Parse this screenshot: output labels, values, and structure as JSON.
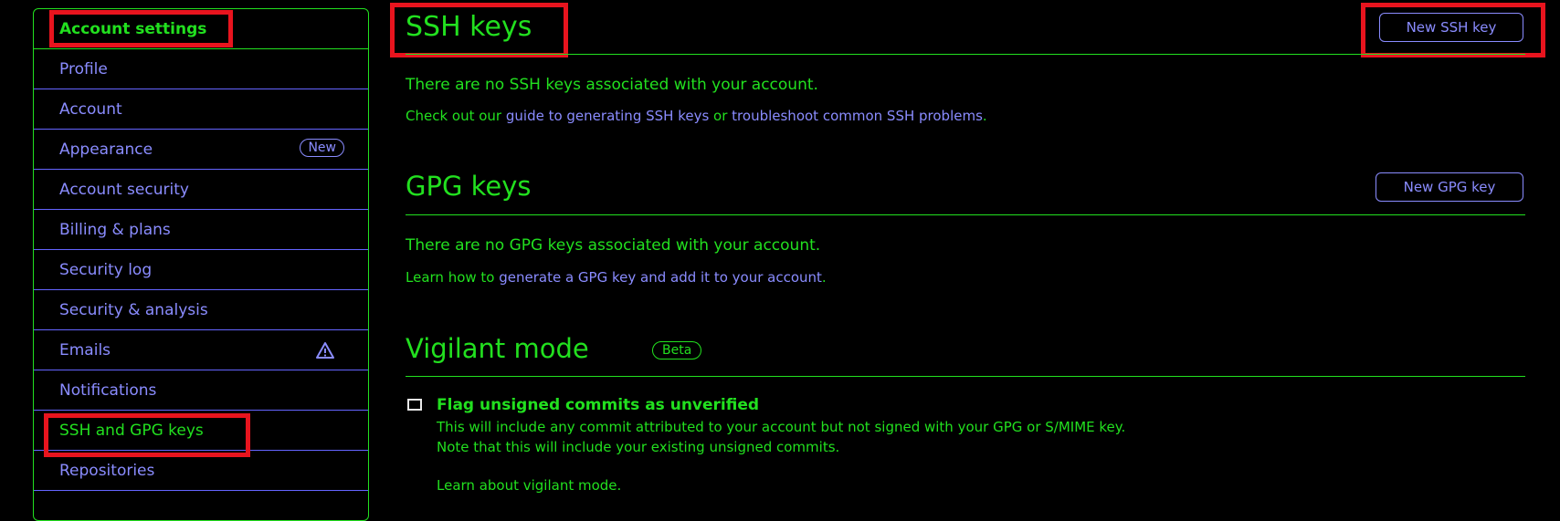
{
  "sidebar": {
    "items": [
      {
        "label": "Account settings"
      },
      {
        "label": "Profile"
      },
      {
        "label": "Account"
      },
      {
        "label": "Appearance",
        "badge": "New"
      },
      {
        "label": "Account security"
      },
      {
        "label": "Billing & plans"
      },
      {
        "label": "Security log"
      },
      {
        "label": "Security & analysis"
      },
      {
        "label": "Emails",
        "icon": "warning-icon"
      },
      {
        "label": "Notifications"
      },
      {
        "label": "SSH and GPG keys"
      },
      {
        "label": "Repositories"
      }
    ]
  },
  "ssh": {
    "title": "SSH keys",
    "button": "New SSH key",
    "empty": "There are no SSH keys associated with your account.",
    "guide_prefix": "Check out our ",
    "guide_link": "guide to generating SSH keys",
    "guide_mid": " or ",
    "troubleshoot_link": "troubleshoot common SSH problems",
    "guide_suffix": "."
  },
  "gpg": {
    "title": "GPG keys",
    "button": "New GPG key",
    "empty": "There are no GPG keys associated with your account.",
    "learn_prefix": "Learn how to ",
    "learn_link": "generate a GPG key and add it to your account",
    "learn_suffix": "."
  },
  "vigilant": {
    "title": "Vigilant mode",
    "badge": "Beta",
    "checkbox_label": "Flag unsigned commits as unverified",
    "desc1": "This will include any commit attributed to your account but not signed with your GPG or S/MIME key.",
    "desc2": "Note that this will include your existing unsigned commits.",
    "learn_link": "Learn about vigilant mode."
  },
  "colors": {
    "accent": "#22e01f",
    "link": "#8a8cff",
    "highlight": "#e8141e"
  }
}
